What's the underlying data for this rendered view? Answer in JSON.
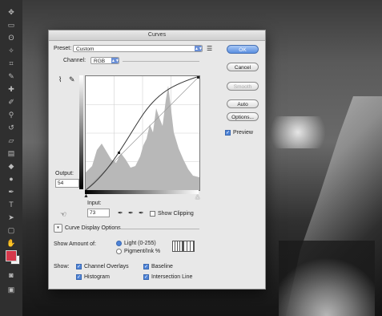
{
  "dialog": {
    "title": "Curves",
    "preset_label": "Preset:",
    "preset_value": "Custom",
    "preset_menu_icon": "list-icon",
    "channel_label": "Channel:",
    "channel_value": "RGB",
    "output_label": "Output:",
    "output_value": "54",
    "input_label": "Input:",
    "input_value": "73",
    "show_clipping": "Show Clipping",
    "display_options_title": "Curve Display Options",
    "show_amount_label": "Show Amount of:",
    "light_option": "Light (0-255)",
    "pigment_option": "Pigment/Ink %",
    "show_label": "Show:",
    "channel_overlays": "Channel Overlays",
    "baseline": "Baseline",
    "histogram": "Histogram",
    "intersection_line": "Intersection Line"
  },
  "buttons": {
    "ok": "OK",
    "cancel": "Cancel",
    "smooth": "Smooth",
    "auto": "Auto",
    "options": "Options...",
    "preview": "Preview"
  },
  "colors": {
    "foreground": "#d6384b",
    "background": "#f2f2f2",
    "accent": "#4d83d8"
  }
}
